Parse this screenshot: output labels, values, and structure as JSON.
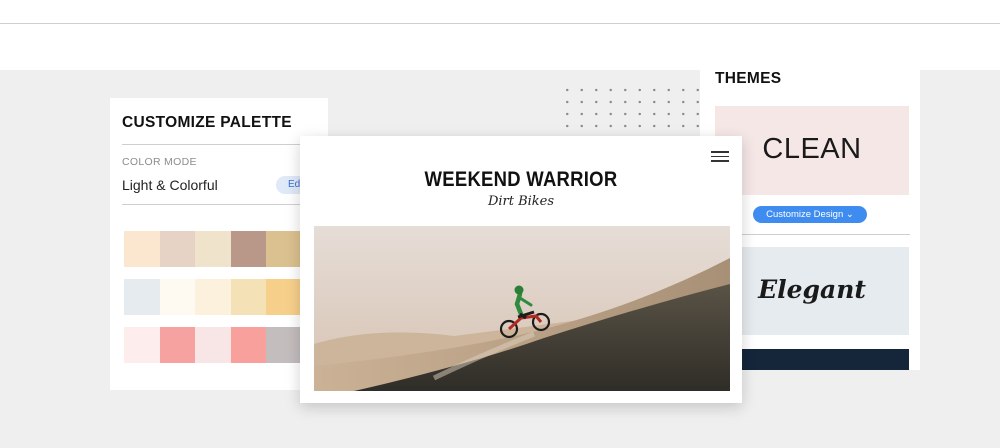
{
  "palette": {
    "title": "CUSTOMIZE PALETTE",
    "color_mode_label": "COLOR MODE",
    "color_mode_value": "Light & Colorful",
    "edit_label": "Edit",
    "swatch_rows": [
      [
        "#fbe6cf",
        "#e6d3c6",
        "#efe3cc",
        "#b9988a",
        "#dbc18f"
      ],
      [
        "#e6ebef",
        "#fffaf1",
        "#fcf1dc",
        "#f4e1b6",
        "#f6d08b"
      ],
      [
        "#fdeeed",
        "#f6a2a0",
        "#f8e6e6",
        "#f7a09c",
        "#c3bdbd"
      ]
    ]
  },
  "preview": {
    "site_title": "WEEKEND WARRIOR",
    "site_subtitle": "Dirt Bikes",
    "menu_icon": "hamburger-menu-icon",
    "hero_image": "dirt-bike-rider-on-sand-dune"
  },
  "themes": {
    "title": "THEMES",
    "clean_label": "CLEAN",
    "customize_button": "Customize Design ⌄",
    "elegant_label": "Elegant"
  },
  "colors": {
    "accent": "#3f8cf0",
    "backdrop": "#efefef",
    "clean_theme_bg": "#f6e7e7",
    "elegant_theme_bg": "#e6ebef",
    "navy_theme_bg": "#15263a"
  }
}
